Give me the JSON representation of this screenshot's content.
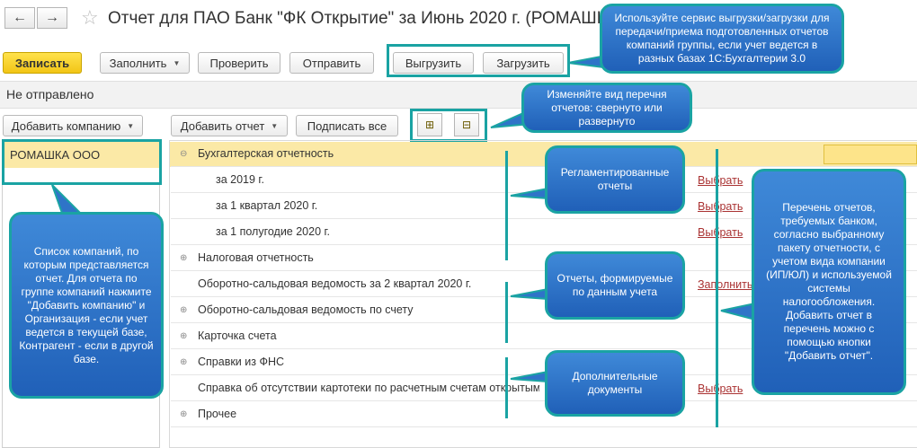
{
  "header": {
    "title": "Отчет для ПАО Банк \"ФК Открытие\" за Июнь 2020 г. (РОМАШКА",
    "back_icon": "←",
    "forward_icon": "→",
    "star_icon": "☆"
  },
  "toolbar": {
    "write": "Записать",
    "fill": "Заполнить",
    "check": "Проверить",
    "send": "Отправить",
    "upload": "Выгрузить",
    "download": "Загрузить"
  },
  "status_text": "Не отправлено",
  "companies": {
    "add_button": "Добавить компанию",
    "items": [
      "РОМАШКА ООО"
    ]
  },
  "reports_toolbar": {
    "add_report": "Добавить отчет",
    "sign_all": "Подписать все"
  },
  "rows": [
    {
      "label": "Бухгалтерская отчетность",
      "icon": "⊖",
      "action": ""
    },
    {
      "label": "за 2019 г.",
      "icon": "",
      "action": "Выбрать"
    },
    {
      "label": "за 1 квартал 2020 г.",
      "icon": "",
      "action": "Выбрать"
    },
    {
      "label": "за 1 полугодие 2020 г.",
      "icon": "",
      "action": "Выбрать"
    },
    {
      "label": "Налоговая отчетность",
      "icon": "⊕",
      "action": ""
    },
    {
      "label": "Оборотно-сальдовая ведомость за 2 квартал 2020 г.",
      "icon": "",
      "action": "Заполнить"
    },
    {
      "label": "Оборотно-сальдовая ведомость по счету",
      "icon": "⊕",
      "action": ""
    },
    {
      "label": "Карточка счета",
      "icon": "⊕",
      "action": ""
    },
    {
      "label": "Справки из ФНС",
      "icon": "⊕",
      "action": ""
    },
    {
      "label": "Справка об отсутствии картотеки по расчетным счетам открытым",
      "icon": "",
      "action": "Выбрать"
    },
    {
      "label": "Прочее",
      "icon": "⊕",
      "action": ""
    }
  ],
  "callouts": {
    "upload": "Используйте сервис выгрузки/загрузки для передачи/приема подготовленных отчетов компаний группы, если учет ведется в разных базах 1С:Бухгалтерии 3.0",
    "view": "Изменяйте вид перечня отчетов: свернуто или развернуто",
    "regulated": "Регламентированные отчеты",
    "accounting": "Отчеты, формируемые по данным учета",
    "additional": "Дополнительные документы",
    "companies": "Список компаний, по которым представляется отчет. Для отчета по группе компаний нажмите \"Добавить компанию\" и Организация - если учет ведется в текущей базе, Контрагент - если в другой базе.",
    "bank_list": "Перечень отчетов, требуемых банком, согласно выбранному пакету отчетности, с учетом вида компании (ИП/ЮЛ) и используемой системы налогообложения. Добавить отчет в перечень можно с помощью кнопки \"Добавить отчет\"."
  },
  "colors": {
    "accent": "#1aa3a3",
    "callout": "#2f74c8",
    "write_button": "#f5d327",
    "selected_row": "#fbe9a6",
    "link": "#a33333"
  }
}
